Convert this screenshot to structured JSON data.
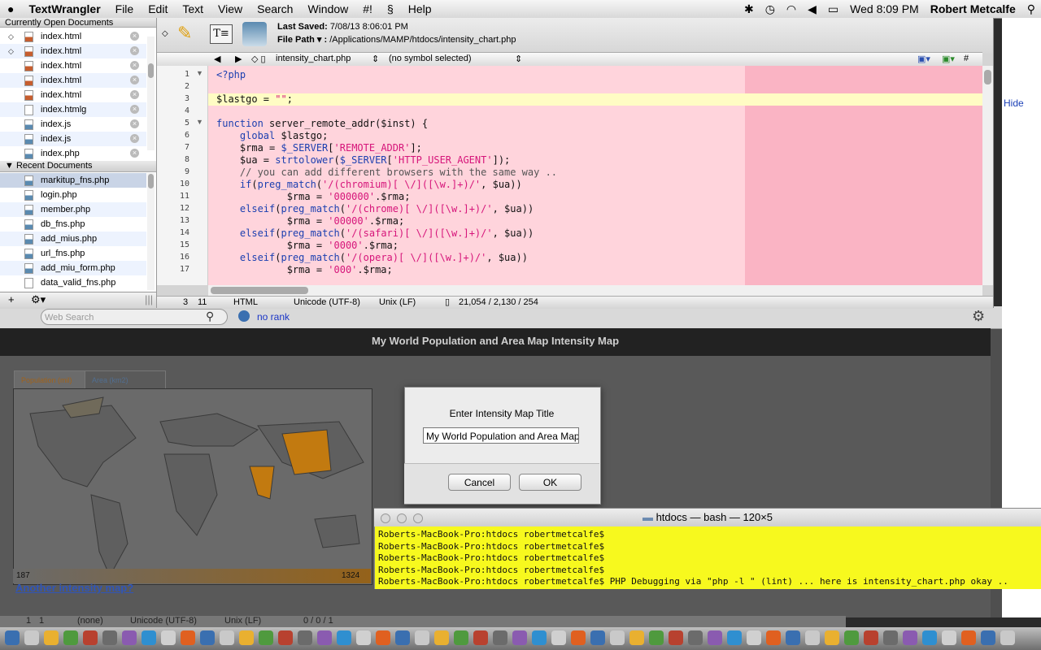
{
  "menubar": {
    "apple": "",
    "app_name": "TextWrangler",
    "items": [
      "File",
      "Edit",
      "Text",
      "View",
      "Search",
      "Window",
      "#!",
      "",
      "Help"
    ],
    "clock": "Wed 8:09 PM",
    "user": "Robert Metcalfe"
  },
  "sidebar": {
    "open_header": "Currently Open Documents",
    "open_docs": [
      "index.html",
      "index.html",
      "index.html",
      "index.html",
      "index.html",
      "index.htmlg",
      "index.js",
      "index.js",
      "index.php"
    ],
    "recent_header": "Recent Documents",
    "recent_docs": [
      "markitup_fns.php",
      "login.php",
      "member.php",
      "db_fns.php",
      "add_mius.php",
      "url_fns.php",
      "add_miu_form.php",
      "data_valid_fns.php"
    ],
    "footer_add": "+"
  },
  "header": {
    "last_saved_label": "Last Saved:",
    "last_saved_value": "7/08/13 8:06:01 PM",
    "file_path_label": "File Path ▾ :",
    "file_path_value": "/Applications/MAMP/htdocs/intensity_chart.php"
  },
  "navbar": {
    "file": "intensity_chart.php",
    "symbol": "(no symbol selected)",
    "hash": "#"
  },
  "editor": {
    "lines": [
      {
        "n": "1",
        "fold": "▼",
        "code": "<?php"
      },
      {
        "n": "2",
        "fold": "",
        "code": ""
      },
      {
        "n": "3",
        "fold": "",
        "code": "$lastgo = \"\";"
      },
      {
        "n": "4",
        "fold": "",
        "code": ""
      },
      {
        "n": "5",
        "fold": "▼",
        "code": "function server_remote_addr($inst) {"
      },
      {
        "n": "6",
        "fold": "",
        "code": "    global $lastgo;"
      },
      {
        "n": "7",
        "fold": "",
        "code": "    $rma = $_SERVER['REMOTE_ADDR'];"
      },
      {
        "n": "8",
        "fold": "",
        "code": "    $ua = strtolower($_SERVER['HTTP_USER_AGENT']);"
      },
      {
        "n": "9",
        "fold": "",
        "code": "    // you can add different browsers with the same way .."
      },
      {
        "n": "10",
        "fold": "",
        "code": "    if(preg_match('/(chromium)[ \\/]([\\w.]+)/', $ua))"
      },
      {
        "n": "11",
        "fold": "",
        "code": "            $rma = '000000'.$rma;"
      },
      {
        "n": "12",
        "fold": "",
        "code": "    elseif(preg_match('/(chrome)[ \\/]([\\w.]+)/', $ua))"
      },
      {
        "n": "13",
        "fold": "",
        "code": "            $rma = '00000'.$rma;"
      },
      {
        "n": "14",
        "fold": "",
        "code": "    elseif(preg_match('/(safari)[ \\/]([\\w.]+)/', $ua))"
      },
      {
        "n": "15",
        "fold": "",
        "code": "            $rma = '0000'.$rma;"
      },
      {
        "n": "16",
        "fold": "",
        "code": "    elseif(preg_match('/(opera)[ \\/]([\\w.]+)/', $ua))"
      },
      {
        "n": "17",
        "fold": "",
        "code": "            $rma = '000'.$rma;"
      }
    ]
  },
  "statusbar": {
    "line": "3",
    "col": "11",
    "lang": "HTML",
    "encoding": "Unicode (UTF-8)",
    "linebreaks": "Unix (LF)",
    "counts": "21,054 / 2,130 / 254"
  },
  "browser": {
    "search_placeholder": "Web Search",
    "rank": "no rank",
    "page_title": "My World Population and Area Map Intensity Map",
    "tab_population": "Population (mil)",
    "tab_area": "Area (km2)",
    "legend_min": "187",
    "legend_max": "1324",
    "another_link": "Another intensity map?",
    "hide_link": "Hide",
    "lower_status": {
      "line": "1",
      "col": "1",
      "symbol": "(none)",
      "encoding": "Unicode (UTF-8)",
      "linebreaks": "Unix (LF)",
      "counts": "0 / 0 / 1"
    }
  },
  "dialog": {
    "title": "Enter Intensity Map Title",
    "input_value": "My World Population and Area Map",
    "cancel": "Cancel",
    "ok": "OK"
  },
  "terminal": {
    "title": "htdocs — bash — 120×5",
    "lines": [
      "Roberts-MacBook-Pro:htdocs robertmetcalfe$",
      "Roberts-MacBook-Pro:htdocs robertmetcalfe$",
      "Roberts-MacBook-Pro:htdocs robertmetcalfe$",
      "Roberts-MacBook-Pro:htdocs robertmetcalfe$",
      "Roberts-MacBook-Pro:htdocs robertmetcalfe$ PHP Debugging via \"php -l \" (lint) ... here is intensity_chart.php okay .."
    ]
  },
  "colors": {
    "editor_bg": "#ffd4dc",
    "editor_right": "#fab4c4",
    "current_line": "#fffcc4",
    "terminal_bg": "#f7f91e",
    "map_highlight": "#c27a10"
  }
}
